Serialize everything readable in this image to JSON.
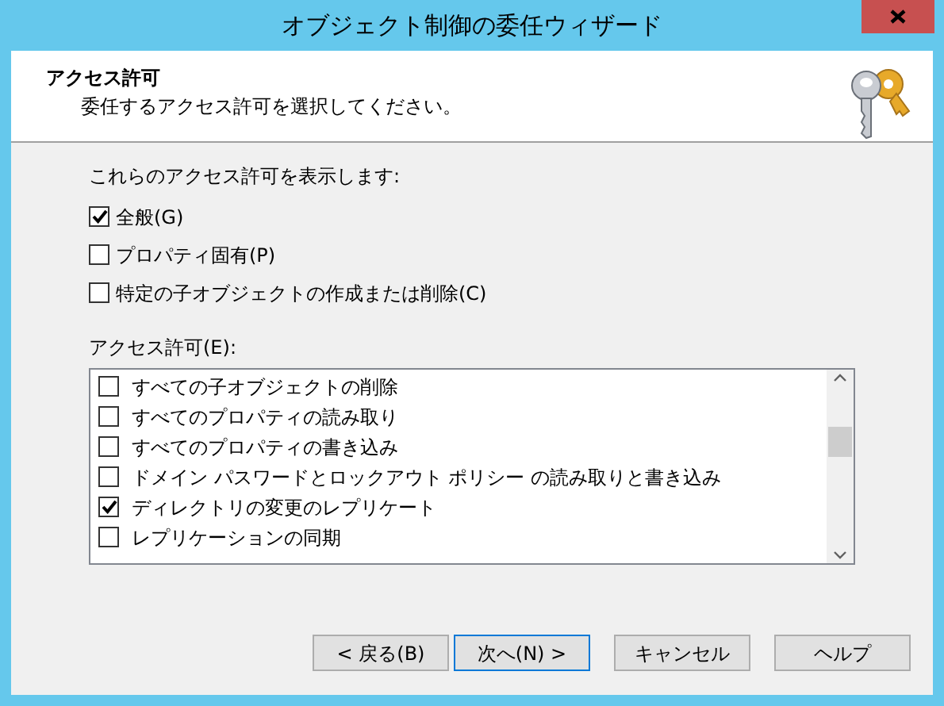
{
  "window": {
    "title": "オブジェクト制御の委任ウィザード"
  },
  "header": {
    "title": "アクセス許可",
    "subtitle": "委任するアクセス許可を選択してください。"
  },
  "filter": {
    "label": "これらのアクセス許可を表示します:",
    "options": [
      {
        "label": "全般(G)",
        "checked": true
      },
      {
        "label": "プロパティ固有(P)",
        "checked": false
      },
      {
        "label": "特定の子オブジェクトの作成または削除(C)",
        "checked": false
      }
    ]
  },
  "permissions": {
    "label": "アクセス許可(E):",
    "items": [
      {
        "label": "すべての子オブジェクトの削除",
        "checked": false
      },
      {
        "label": "すべてのプロパティの読み取り",
        "checked": false
      },
      {
        "label": "すべてのプロパティの書き込み",
        "checked": false
      },
      {
        "label": "ドメイン パスワードとロックアウト ポリシー の読み取りと書き込み",
        "checked": false
      },
      {
        "label": "ディレクトリの変更のレプリケート",
        "checked": true
      },
      {
        "label": "レプリケーションの同期",
        "checked": false
      }
    ]
  },
  "buttons": [
    {
      "label": "< 戻る(B)",
      "kind": "normal"
    },
    {
      "label": "次へ(N) >",
      "kind": "default"
    },
    {
      "label": "キャンセル",
      "kind": "normal"
    },
    {
      "label": "ヘルプ",
      "kind": "normal"
    }
  ]
}
